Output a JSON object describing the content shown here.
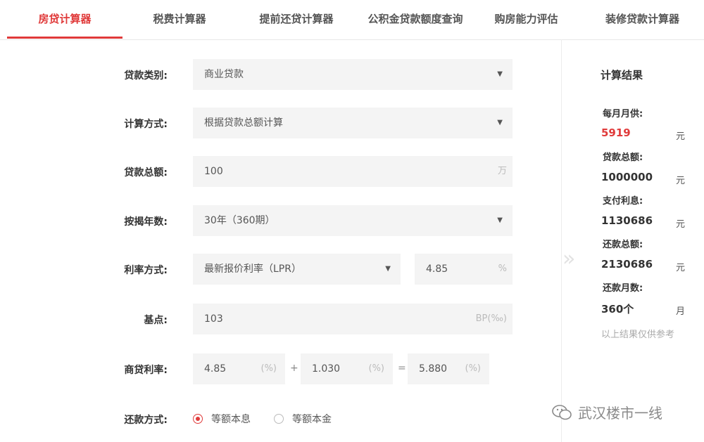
{
  "tabs": [
    {
      "label": "房贷计算器",
      "active": true
    },
    {
      "label": "税费计算器",
      "active": false
    },
    {
      "label": "提前还贷计算器",
      "active": false
    },
    {
      "label": "公积金贷款额度查询",
      "active": false
    },
    {
      "label": "购房能力评估",
      "active": false
    },
    {
      "label": "装修贷款计算器",
      "active": false
    }
  ],
  "form": {
    "loan_type": {
      "label": "贷款类别:",
      "value": "商业贷款"
    },
    "calc_method": {
      "label": "计算方式:",
      "value": "根据贷款总额计算"
    },
    "loan_amount": {
      "label": "贷款总额:",
      "value": "100",
      "unit": "万"
    },
    "years": {
      "label": "按揭年数:",
      "value": "30年（360期）"
    },
    "rate_method": {
      "label": "利率方式:",
      "value": "最新报价利率（LPR）",
      "rate": "4.85",
      "rate_unit": "%"
    },
    "basis_points": {
      "label": "基点:",
      "value": "103",
      "unit": "BP(‰)"
    },
    "commercial_rate": {
      "label": "商贷利率:",
      "base": "4.85",
      "base_unit": "(%)",
      "plus": "+",
      "add": "1.030",
      "add_unit": "(%)",
      "equals": "=",
      "result": "5.880",
      "result_unit": "(%)"
    },
    "repayment": {
      "label": "还款方式:",
      "options": [
        "等额本息",
        "等额本金"
      ],
      "selected": "等额本息"
    }
  },
  "results": {
    "title": "计算结果",
    "monthly": {
      "label": "每月月供:",
      "value": "5919",
      "unit": "元"
    },
    "total_loan": {
      "label": "贷款总额:",
      "value": "1000000",
      "unit": "元"
    },
    "interest": {
      "label": "支付利息:",
      "value": "1130686",
      "unit": "元"
    },
    "total_repay": {
      "label": "还款总额:",
      "value": "2130686",
      "unit": "元"
    },
    "months": {
      "label": "还款月数:",
      "value": "360个",
      "unit": "月"
    },
    "note": "以上结果仅供参考"
  },
  "watermark": "武汉楼市一线",
  "colors": {
    "accent": "#e03a3a",
    "field_bg": "#f4f4f4"
  }
}
